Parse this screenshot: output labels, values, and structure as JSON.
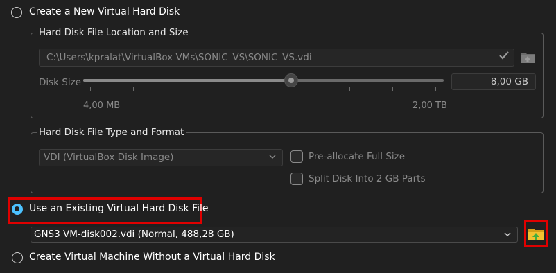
{
  "options": {
    "create_new": "Create a New Virtual Hard Disk",
    "use_existing": "Use an Existing Virtual Hard Disk File",
    "no_disk": "Create Virtual Machine Without a Virtual Hard Disk"
  },
  "location_group": {
    "legend": "Hard Disk File Location and Size",
    "path": "C:\\Users\\kpralat\\VirtualBox VMs\\SONIC_VS\\SONIC_VS.vdi",
    "disk_size_label": "Disk Size",
    "disk_size_value": "8,00 GB",
    "slider_min": "4,00 MB",
    "slider_max": "2,00 TB",
    "slider_fraction": 0.58
  },
  "format_group": {
    "legend": "Hard Disk File Type and Format",
    "format_value": "VDI (VirtualBox Disk Image)",
    "preallocate": "Pre-allocate Full Size",
    "split": "Split Disk Into 2 GB Parts"
  },
  "existing": {
    "selected_disk": "GNS3 VM-disk002.vdi (Normal, 488,28 GB)"
  },
  "colors": {
    "accent": "#4cc2ff",
    "highlight": "#e00000",
    "background": "#202020"
  }
}
